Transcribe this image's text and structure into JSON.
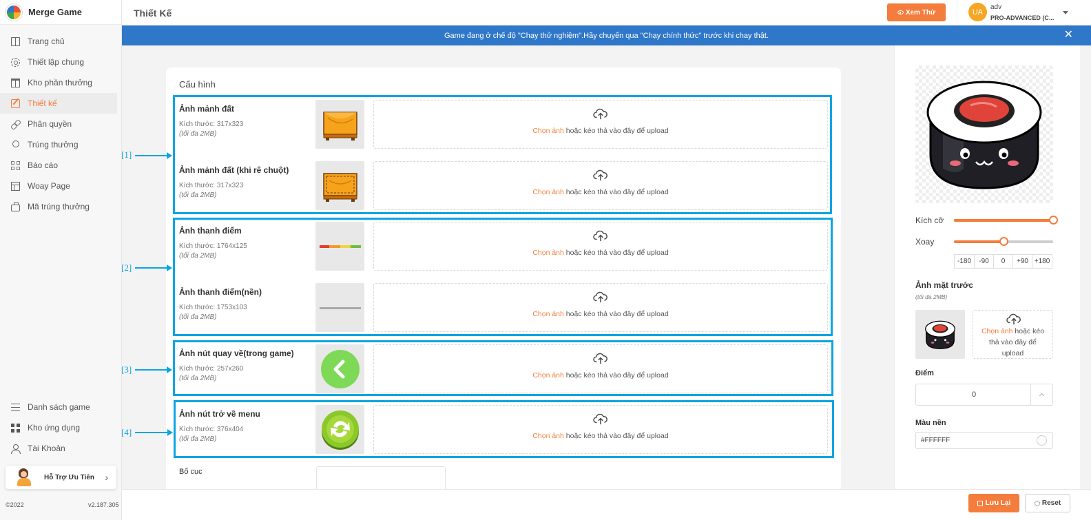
{
  "app": {
    "name": "Merge Game",
    "version": "v2.187.305",
    "copyright": "©2022"
  },
  "sidebar": {
    "items": [
      {
        "label": "Trang chủ",
        "icon": "book-icon"
      },
      {
        "label": "Thiết lập chung",
        "icon": "gear-icon"
      },
      {
        "label": "Kho phần thưởng",
        "icon": "gift-icon"
      },
      {
        "label": "Thiết kế",
        "icon": "edit-icon",
        "active": true
      },
      {
        "label": "Phân quyền",
        "icon": "link-icon"
      },
      {
        "label": "Trúng thưởng",
        "icon": "award-icon"
      },
      {
        "label": "Báo cáo",
        "icon": "grid-icon"
      },
      {
        "label": "Woay Page",
        "icon": "page-icon"
      },
      {
        "label": "Mã trúng thưởng",
        "icon": "briefcase-icon"
      }
    ],
    "bottom_items": [
      {
        "label": "Danh sách game",
        "icon": "list-icon"
      },
      {
        "label": "Kho ứng dụng",
        "icon": "apps-icon"
      },
      {
        "label": "Tài Khoản",
        "icon": "user-icon"
      }
    ],
    "support_label": "Hỗ Trợ Ưu Tiên"
  },
  "header": {
    "title": "Thiết Kế",
    "preview_label": "Xem Thử",
    "user": {
      "initials": "UA",
      "name": "adv",
      "plan": "PRO-ADVANCED (C..."
    }
  },
  "banner": {
    "text": "Game đang ở chế độ \"Chạy thử nghiệm\".Hãy chuyển qua \"Chạy chính thức\" trước khi chay thật.",
    "close": "✕"
  },
  "config": {
    "title": "Cấu hình",
    "upload_link": "Chọn ảnh",
    "upload_rest": " hoặc kéo thả vào đây để upload",
    "rows": [
      {
        "label": "Ảnh mảnh đất",
        "size": "Kích thước: 317x323",
        "limit": "(tối đa 2MB)",
        "thumb": "land-tile"
      },
      {
        "label": "Ảnh mảnh đất (khi rê chuột)",
        "size": "Kích thước: 317x323",
        "limit": "(tối đa 2MB)",
        "thumb": "land-tile-hover"
      },
      {
        "label": "Ảnh thanh điểm",
        "size": "Kích thước: 1764x125",
        "limit": "(tối đa 2MB)",
        "thumb": "score-bar"
      },
      {
        "label": "Ảnh thanh điểm(nền)",
        "size": "Kích thước: 1753x103",
        "limit": "(tối đa 2MB)",
        "thumb": "score-bar-bg"
      },
      {
        "label": "Ảnh nút quay về(trong game)",
        "size": "Kích thước: 257x260",
        "limit": "(tối đa 2MB)",
        "thumb": "back-button"
      },
      {
        "label": "Ảnh nút trở về menu",
        "size": "Kích thước: 376x404",
        "limit": "(tối đa 2MB)",
        "thumb": "menu-button"
      }
    ],
    "layout_label": "Bố cục"
  },
  "annotations": [
    "[1]",
    "[2]",
    "[3]",
    "[4]"
  ],
  "right_panel": {
    "size_label": "Kích cỡ",
    "size_value": 1.0,
    "rotate_label": "Xoay",
    "rotate_value": 0,
    "rotate_range": [
      -180,
      180
    ],
    "rotate_buttons": [
      "-180",
      "-90",
      "0",
      "+90",
      "+180"
    ],
    "front_title": "Ảnh mặt trước",
    "front_limit": "(tối đa 2MB)",
    "front_upload_link": "Chọn ảnh",
    "front_upload_rest": " hoặc kéo thả vào đây để upload",
    "score_label": "Điểm",
    "score_value": "0",
    "bg_color_label": "Màu nền",
    "bg_color_value": "#FFFFFF"
  },
  "footer": {
    "save_label": "Lưu Lại",
    "reset_label": "Reset"
  },
  "colors": {
    "accent": "#f47c3c",
    "banner": "#2f77c9",
    "annotation": "#0ba5e0"
  }
}
